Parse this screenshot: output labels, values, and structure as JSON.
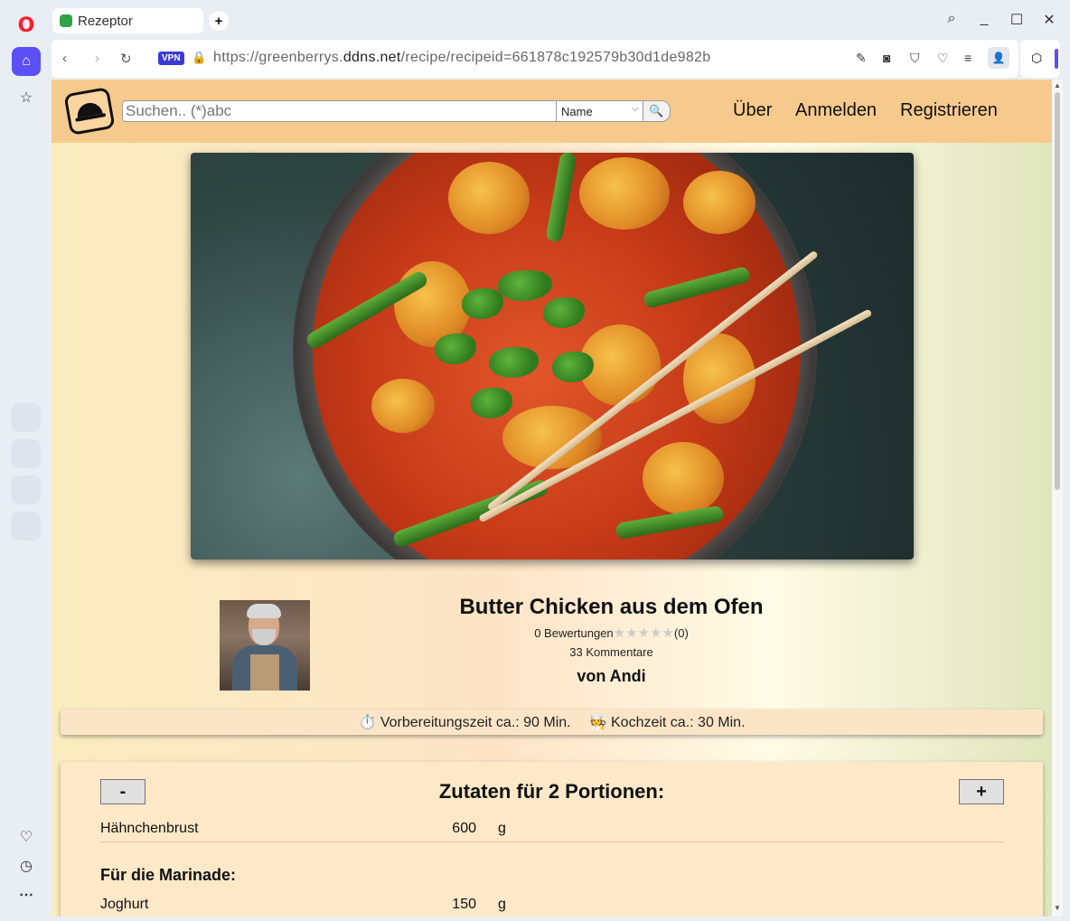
{
  "browser": {
    "tab_title": "Rezeptor",
    "new_tab": "+",
    "vpn_label": "VPN",
    "url_prefix": "https://greenberrys.",
    "url_domain": "ddns.net",
    "url_path": "/recipe/recipeid=661878c192579b30d1de982b"
  },
  "site": {
    "search_placeholder": "Suchen.. (*)abc",
    "search_mode": "Name",
    "nav": [
      "Über",
      "Anmelden",
      "Registrieren"
    ]
  },
  "recipe": {
    "title": "Butter Chicken aus dem Ofen",
    "ratings_label": "0 Bewertungen",
    "stars": "★★★★★",
    "rating_count": "(0)",
    "comments": "33 Kommentare",
    "author": "von Andi",
    "prep_time": "⏱️ Vorbereitungszeit ca.: 90 Min.",
    "cook_time": "🧑‍🍳 Kochzeit ca.: 30 Min."
  },
  "ingredients": {
    "minus": "-",
    "plus": "+",
    "heading": "Zutaten für 2 Portionen:",
    "items": [
      {
        "name": "Hähnchenbrust",
        "qty": "600",
        "unit": "g"
      }
    ],
    "section": "Für die Marinade:",
    "section_items": [
      {
        "name": "Joghurt",
        "qty": "150",
        "unit": "g"
      }
    ]
  },
  "colors": {
    "header_bg": "#f6ca8d",
    "accent": "#5b4ff5"
  }
}
